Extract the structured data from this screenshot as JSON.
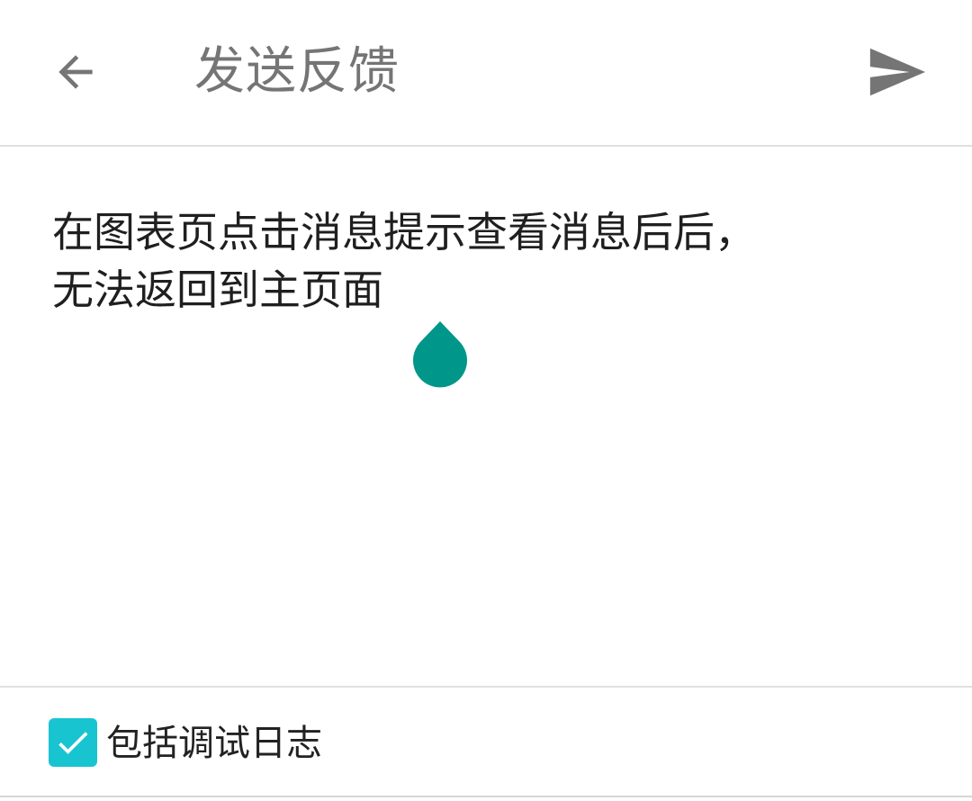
{
  "toolbar": {
    "back_icon": "arrow-back-icon",
    "title": "发送反馈",
    "send_icon": "send-icon",
    "icon_color": "#757575"
  },
  "editor": {
    "text": "在图表页点击消息提示查看消息后后，\n无法返回到主页面",
    "cursor_handle_icon": "text-cursor-handle-icon",
    "cursor_handle_color": "#00968a"
  },
  "footer": {
    "include_logs_checked": true,
    "include_logs_label": "包括调试日志",
    "checkbox_color": "#19c4d1"
  }
}
